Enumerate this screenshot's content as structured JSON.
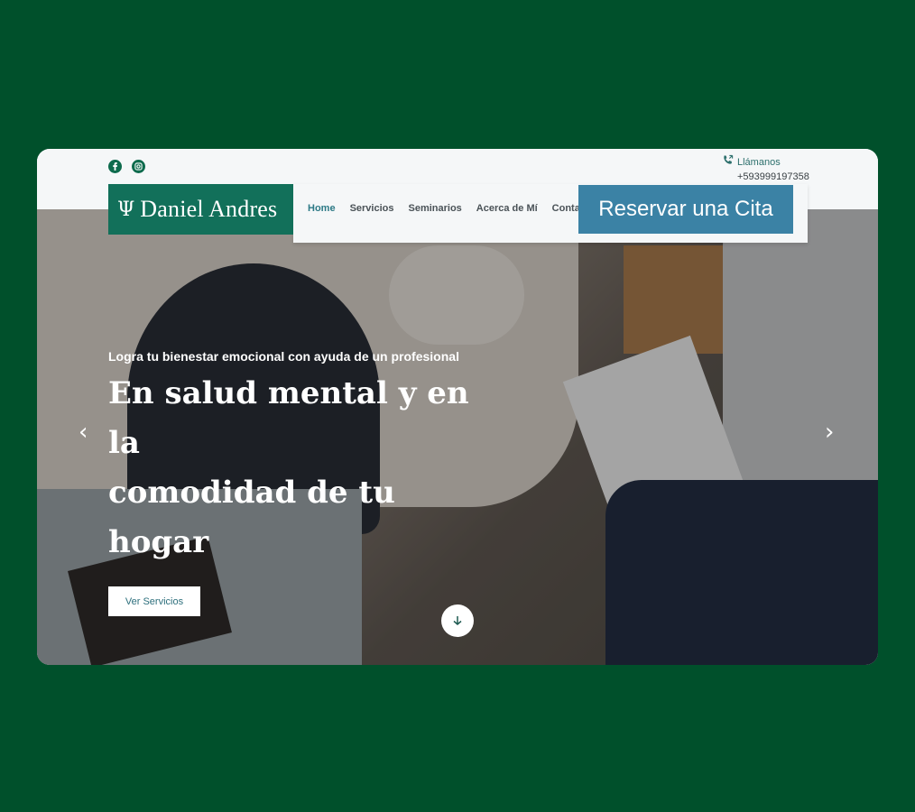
{
  "brand": {
    "name": "Daniel Andres",
    "logo_icon": "psi-icon"
  },
  "social": [
    {
      "icon": "facebook-icon"
    },
    {
      "icon": "instagram-icon"
    }
  ],
  "contact": {
    "label": "Llámanos",
    "phone": "+593999197358",
    "icon": "phone-icon"
  },
  "nav": {
    "items": [
      "Home",
      "Servicios",
      "Seminarios",
      "Acerca de Mí",
      "Contacto"
    ],
    "active": "Home"
  },
  "cta": {
    "label": "Reservar una Cita"
  },
  "hero": {
    "eyebrow": "Logra tu bienestar emocional con ayuda de un profesional",
    "headline_line1": "En salud mental y en la",
    "headline_line2": "comodidad de tu hogar",
    "button_label": "Ver Servicios"
  },
  "colors": {
    "page_bg": "#00502b",
    "brand_green": "#12705a",
    "cta_blue": "#3b82a5",
    "nav_active": "#2d7a86"
  }
}
